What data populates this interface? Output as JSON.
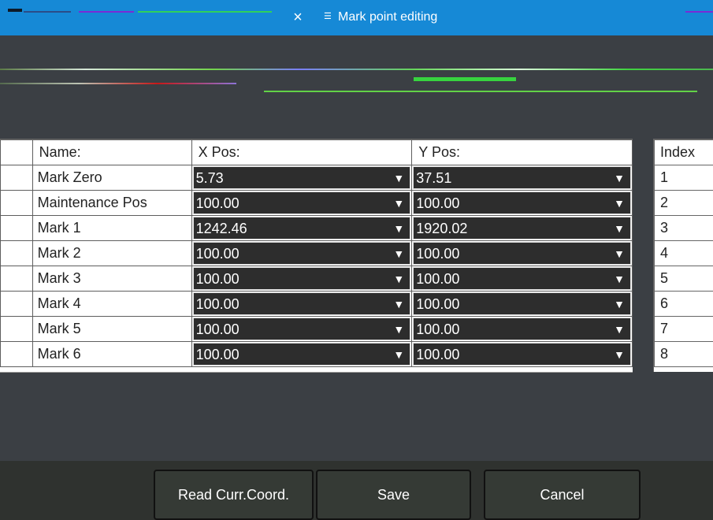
{
  "window": {
    "title": "Mark point editing",
    "close_label": "×",
    "icon": "list-icon"
  },
  "grid": {
    "headers": [
      "Name:",
      "X Pos:",
      "Y Pos:"
    ],
    "rows": [
      {
        "name": "Mark Zero",
        "x": "5.73",
        "y": "37.51"
      },
      {
        "name": "Maintenance Pos",
        "x": "100.00",
        "y": "100.00"
      },
      {
        "name": "Mark 1",
        "x": "1242.46",
        "y": "1920.02"
      },
      {
        "name": "Mark 2",
        "x": "100.00",
        "y": "100.00"
      },
      {
        "name": "Mark 3",
        "x": "100.00",
        "y": "100.00"
      },
      {
        "name": "Mark 4",
        "x": "100.00",
        "y": "100.00"
      },
      {
        "name": "Mark 5",
        "x": "100.00",
        "y": "100.00"
      },
      {
        "name": "Mark 6",
        "x": "100.00",
        "y": "100.00"
      }
    ]
  },
  "index_table": {
    "header": "Index",
    "values": [
      "1",
      "2",
      "3",
      "4",
      "5",
      "6",
      "7",
      "8"
    ]
  },
  "buttons": {
    "read_coord": "Read Curr.Coord.",
    "save": "Save",
    "cancel": "Cancel"
  }
}
